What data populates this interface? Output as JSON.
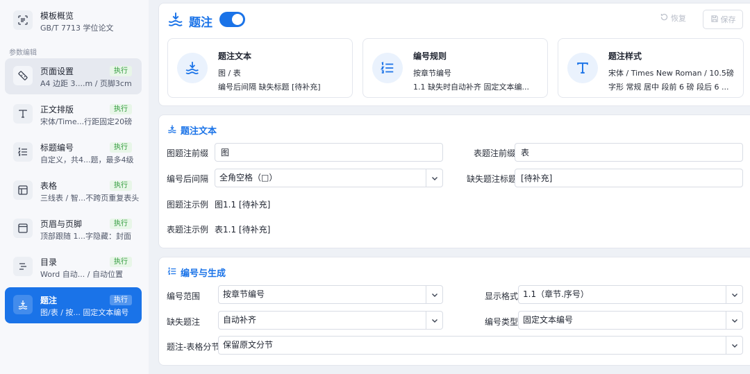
{
  "sidebar": {
    "overview": {
      "title": "模板概览",
      "sub": "GB/T 7713 学位论文",
      "icon": "scan-document-icon"
    },
    "section_label": "参数编辑",
    "items": [
      {
        "title": "页面设置",
        "sub": "A4  边距 3....m / 页脚3cm",
        "badge": "执行",
        "icon": "ruler-icon"
      },
      {
        "title": "正文排版",
        "sub": "宋体/Time...行距固定20磅",
        "badge": "执行",
        "icon": "text-type-icon"
      },
      {
        "title": "标题编号",
        "sub": "自定义，共4...题，最多4级",
        "badge": "执行",
        "icon": "numbered-list-icon"
      },
      {
        "title": "表格",
        "sub": "三线表 / 智...不跨页重复表头",
        "badge": "执行",
        "icon": "table-icon"
      },
      {
        "title": "页眉与页脚",
        "sub": "顶部跟随 1...字隐藏：封面",
        "badge": "执行",
        "icon": "header-footer-icon"
      },
      {
        "title": "目录",
        "sub": "Word 自动... / 自动位置",
        "badge": "执行",
        "icon": "toc-icon"
      },
      {
        "title": "题注",
        "sub": "图/表 / 按... 固定文本编号",
        "badge": "执行",
        "icon": "caption-icon"
      }
    ]
  },
  "header": {
    "title": "题注",
    "toggle_on": true,
    "restore_label": "恢复",
    "save_label": "保存"
  },
  "summary": [
    {
      "title": "题注文本",
      "line1": "图 / 表",
      "line2": "编号后间隔        缺失标题 [待补充]",
      "icon": "caption-icon"
    },
    {
      "title": "编号规则",
      "line1": "按章节编号",
      "line2": "1.1  缺失时自动补齐  固定文本编...",
      "icon": "numbered-list-icon"
    },
    {
      "title": "题注样式",
      "line1": "宋体 / Times New Roman / 10.5磅",
      "line2": "字形 常规  居中  段前 6 磅  段后 6 ...",
      "icon": "text-type-icon"
    }
  ],
  "caption_text": {
    "title": "题注文本",
    "figure_prefix_label": "图题注前缀",
    "figure_prefix_value": "图",
    "table_prefix_label": "表题注前缀",
    "table_prefix_value": "表",
    "gap_label": "编号后间隔",
    "gap_value": "全角空格（□）",
    "missing_label": "缺失题注标题",
    "missing_value": "[待补充]",
    "figure_example_label": "图题注示例",
    "figure_example_value": "图1.1    [待补充]",
    "table_example_label": "表题注示例",
    "table_example_value": "表1.1    [待补充]"
  },
  "numbering": {
    "title": "编号与生成",
    "scope_label": "编号范围",
    "scope_value": "按章节编号",
    "format_label": "显示格式",
    "format_value": "1.1（章节.序号）",
    "missing_label": "缺失题注",
    "missing_value": "自动补齐",
    "type_label": "编号类型",
    "type_value": "固定文本编号",
    "section_break_label": "题注-表格分节",
    "section_break_value": "保留原文分节"
  },
  "colors": {
    "accent": "#1a73e8",
    "badge_text": "#2e9a3a",
    "badge_bg": "#e8f6e8"
  }
}
